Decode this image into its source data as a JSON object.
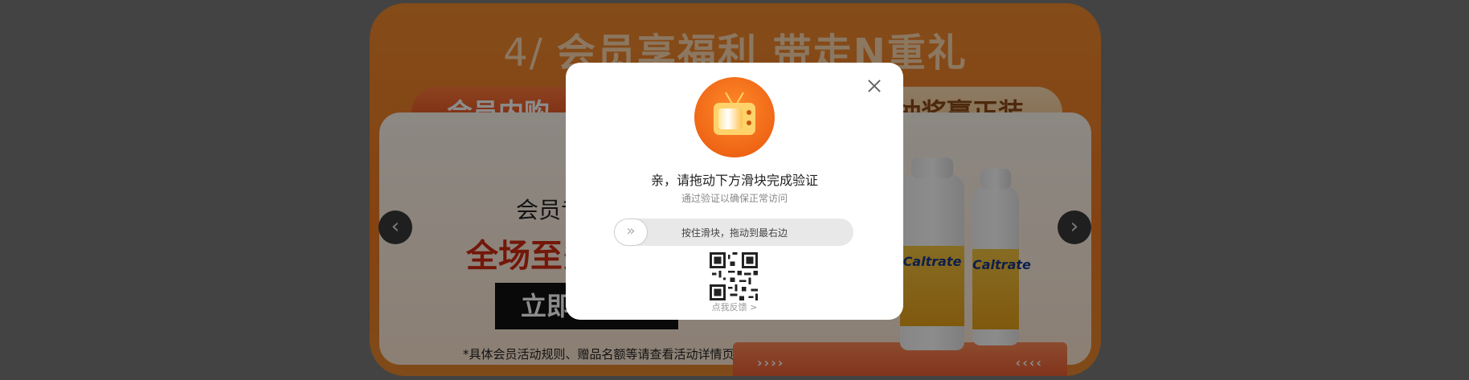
{
  "banner": {
    "step_number": "4/",
    "title": "会员享福利 带走N重礼",
    "tab_left": "会员内购",
    "tab_right": "抽奖赢正装",
    "member_text": "会员专",
    "discount_text": "全场至多",
    "cta_label": "立即",
    "footnote": "*具体会员活动规则、赠品名额等请查看活动详情页。",
    "product_brand": "Caltrate",
    "stage_chevrons_left": "››››",
    "stage_chevrons_right": "‹‹‹‹",
    "prev_arrow": "‹",
    "next_arrow": "›"
  },
  "modal": {
    "title": "亲，请拖动下方滑块完成验证",
    "subtitle": "通过验证以确保正常访问",
    "slider_hint": "按住滑块，拖动到最右边",
    "slider_handle_glyph": "»",
    "feedback": "点我反馈 >",
    "icons": {
      "logo": "tv-icon",
      "close": "close-icon",
      "qr": "qr-code-icon"
    }
  },
  "colors": {
    "banner_orange": "#f27a22",
    "brand_orange": "#ff8a2a",
    "overlay": "rgba(0,0,0,0.45)"
  }
}
